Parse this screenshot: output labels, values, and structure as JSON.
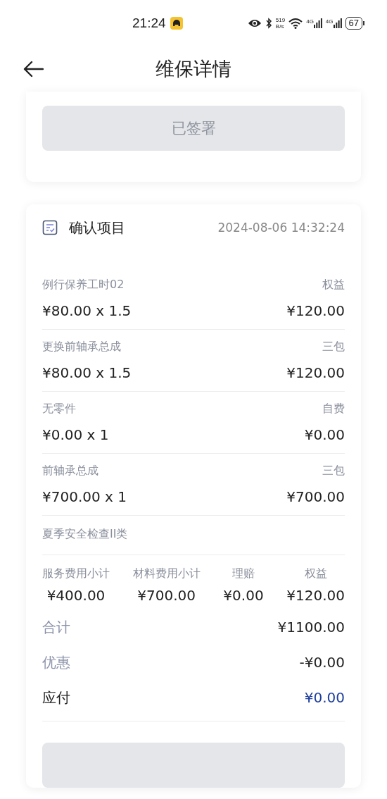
{
  "status_bar": {
    "time": "21:24",
    "speed_value": "519",
    "speed_unit": "B/s",
    "networks": [
      "4G",
      "4G"
    ],
    "battery": "67"
  },
  "header": {
    "title": "维保详情"
  },
  "signed_button": {
    "label": "已签署",
    "disabled": true
  },
  "confirm_card": {
    "title": "确认项目",
    "datetime": "2024-08-06 14:32:24",
    "items": [
      {
        "kind": "priced",
        "name": "例行保养工时02",
        "tag": "权益",
        "formula": "¥80.00 x 1.5",
        "amount": "¥120.00"
      },
      {
        "kind": "priced",
        "name": "更换前轴承总成",
        "tag": "三包",
        "formula": "¥80.00 x 1.5",
        "amount": "¥120.00"
      },
      {
        "kind": "priced",
        "name": "无零件",
        "tag": "自费",
        "formula": "¥0.00 x 1",
        "amount": "¥0.00"
      },
      {
        "kind": "priced",
        "name": "前轴承总成",
        "tag": "三包",
        "formula": "¥700.00 x 1",
        "amount": "¥700.00"
      },
      {
        "kind": "plain",
        "name": "夏季安全检查II类"
      }
    ],
    "subtotals": [
      {
        "label": "服务费用小计",
        "value": "¥400.00"
      },
      {
        "label": "材料费用小计",
        "value": "¥700.00"
      },
      {
        "label": "理赔",
        "value": "¥0.00"
      },
      {
        "label": "权益",
        "value": "¥120.00"
      }
    ],
    "totals": [
      {
        "kind": "muted",
        "label": "合计",
        "value": "¥1100.00"
      },
      {
        "kind": "muted",
        "label": "优惠",
        "value": "-¥0.00"
      },
      {
        "kind": "payable",
        "label": "应付",
        "value": "¥0.00"
      }
    ]
  },
  "bottom_button": {
    "disabled": true
  }
}
